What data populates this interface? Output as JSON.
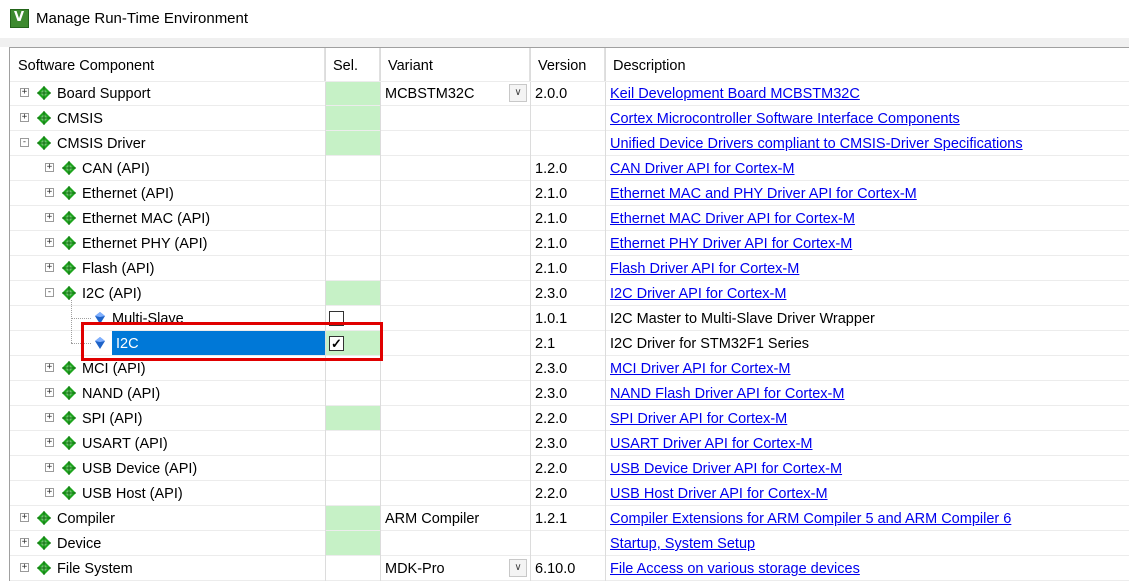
{
  "window": {
    "title": "Manage Run-Time Environment",
    "icon": "keil-mdk-icon"
  },
  "columns": [
    "Software Component",
    "Sel.",
    "Variant",
    "Version",
    "Description"
  ],
  "rows": [
    {
      "name": "Board Support",
      "level": 0,
      "kind": "group",
      "expand": "+",
      "sel": "green",
      "variant": "MCBSTM32C",
      "dropdown": true,
      "version": "2.0.0",
      "desc": "Keil Development Board MCBSTM32C",
      "link": true
    },
    {
      "name": "CMSIS",
      "level": 0,
      "kind": "group",
      "expand": "+",
      "sel": "green",
      "variant": "",
      "version": "",
      "desc": "Cortex Microcontroller Software Interface Components",
      "link": true
    },
    {
      "name": "CMSIS Driver",
      "level": 0,
      "kind": "group",
      "expand": "-",
      "sel": "green",
      "variant": "",
      "version": "",
      "desc": "Unified Device Drivers compliant to CMSIS-Driver Specifications",
      "link": true
    },
    {
      "name": "CAN (API)",
      "level": 1,
      "kind": "group",
      "expand": "+",
      "sel": "",
      "variant": "",
      "version": "1.2.0",
      "desc": "CAN Driver API for Cortex-M",
      "link": true
    },
    {
      "name": "Ethernet (API)",
      "level": 1,
      "kind": "group",
      "expand": "+",
      "sel": "",
      "variant": "",
      "version": "2.1.0",
      "desc": "Ethernet MAC and PHY Driver API for Cortex-M",
      "link": true
    },
    {
      "name": "Ethernet MAC (API)",
      "level": 1,
      "kind": "group",
      "expand": "+",
      "sel": "",
      "variant": "",
      "version": "2.1.0",
      "desc": "Ethernet MAC Driver API for Cortex-M",
      "link": true
    },
    {
      "name": "Ethernet PHY (API)",
      "level": 1,
      "kind": "group",
      "expand": "+",
      "sel": "",
      "variant": "",
      "version": "2.1.0",
      "desc": "Ethernet PHY Driver API for Cortex-M",
      "link": true
    },
    {
      "name": "Flash (API)",
      "level": 1,
      "kind": "group",
      "expand": "+",
      "sel": "",
      "variant": "",
      "version": "2.1.0",
      "desc": "Flash Driver API for Cortex-M",
      "link": true
    },
    {
      "name": "I2C (API)",
      "level": 1,
      "kind": "group",
      "expand": "-",
      "sel": "green",
      "variant": "",
      "version": "2.3.0",
      "desc": "I2C Driver API for Cortex-M",
      "link": true
    },
    {
      "name": "Multi-Slave",
      "level": 2,
      "kind": "leaf",
      "expand": "",
      "sel": "checkbox",
      "checked": false,
      "variant": "",
      "version": "1.0.1",
      "desc": "I2C Master to Multi-Slave Driver Wrapper",
      "link": false
    },
    {
      "name": "I2C",
      "level": 2,
      "kind": "leaf",
      "expand": "",
      "sel": "checkbox-green",
      "checked": true,
      "selected": true,
      "variant": "",
      "version": "2.1",
      "desc": "I2C Driver for STM32F1 Series",
      "link": false
    },
    {
      "name": "MCI (API)",
      "level": 1,
      "kind": "group",
      "expand": "+",
      "sel": "",
      "variant": "",
      "version": "2.3.0",
      "desc": "MCI Driver API for Cortex-M",
      "link": true
    },
    {
      "name": "NAND (API)",
      "level": 1,
      "kind": "group",
      "expand": "+",
      "sel": "",
      "variant": "",
      "version": "2.3.0",
      "desc": "NAND Flash Driver API for Cortex-M",
      "link": true
    },
    {
      "name": "SPI (API)",
      "level": 1,
      "kind": "group",
      "expand": "+",
      "sel": "green",
      "variant": "",
      "version": "2.2.0",
      "desc": "SPI Driver API for Cortex-M",
      "link": true
    },
    {
      "name": "USART (API)",
      "level": 1,
      "kind": "group",
      "expand": "+",
      "sel": "",
      "variant": "",
      "version": "2.3.0",
      "desc": "USART Driver API for Cortex-M",
      "link": true
    },
    {
      "name": "USB Device (API)",
      "level": 1,
      "kind": "group",
      "expand": "+",
      "sel": "",
      "variant": "",
      "version": "2.2.0",
      "desc": "USB Device Driver API for Cortex-M",
      "link": true
    },
    {
      "name": "USB Host (API)",
      "level": 1,
      "kind": "group",
      "expand": "+",
      "sel": "",
      "variant": "",
      "version": "2.2.0",
      "desc": "USB Host Driver API for Cortex-M",
      "link": true
    },
    {
      "name": "Compiler",
      "level": 0,
      "kind": "group",
      "expand": "+",
      "sel": "green",
      "variant": "ARM Compiler",
      "version": "1.2.1",
      "desc": "Compiler Extensions for ARM Compiler 5 and ARM Compiler 6",
      "link": true
    },
    {
      "name": "Device",
      "level": 0,
      "kind": "group",
      "expand": "+",
      "sel": "green",
      "variant": "",
      "version": "",
      "desc": "Startup, System Setup",
      "link": true
    },
    {
      "name": "File System",
      "level": 0,
      "kind": "group",
      "expand": "+",
      "sel": "",
      "variant": "MDK-Pro",
      "dropdown": true,
      "version": "6.10.0",
      "desc": "File Access on various storage devices",
      "link": true
    }
  ],
  "colors": {
    "green": "#c6f1c6",
    "selection": "#0078d7",
    "link": "#0000ee",
    "diamond": "#1fa51f",
    "highlight": "#e00000"
  }
}
